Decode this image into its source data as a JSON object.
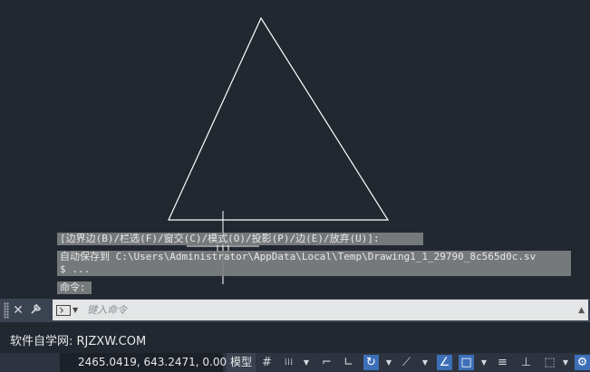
{
  "history": {
    "line1": " [边界边(B)/栏选(F)/窗交(C)/模式(O)/投影(P)/边(E)/放弃(U)]:",
    "line2a": "自动保存到 C:\\Users\\Administrator\\AppData\\Local\\Temp\\Drawing1_1_29790_8c565d0c.sv",
    "line2b": "$ ...",
    "line3": "命令:"
  },
  "command_bar": {
    "placeholder": "键入命令",
    "close_icon": "close-icon",
    "settings_icon": "wrench-icon"
  },
  "watermark": "软件自学网: RJZXW.COM",
  "status": {
    "coordinates": "2465.0419, 643.2471, 0.0000",
    "model_label": "模型"
  },
  "colors": {
    "canvas": "#212830",
    "command_bar": "#3b4350",
    "status_active": "#3d6fb8"
  }
}
